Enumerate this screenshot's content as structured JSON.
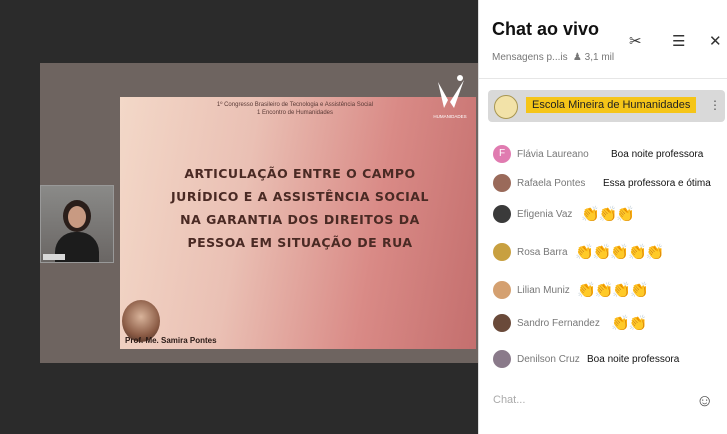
{
  "slide": {
    "header_line1": "1º Congresso Brasileiro de Tecnologia e Assistência Social",
    "header_line2": "1 Encontro de Humanidades",
    "title": "ARTICULAÇÃO ENTRE O CAMPO JURÍDICO E A ASSISTÊNCIA SOCIAL NA GARANTIA DOS DIREITOS DA PESSOA EM SITUAÇÃO DE RUA",
    "presenter": "Prof. Me. Samira Pontes",
    "logo_text": "HUMANIDADES"
  },
  "chat": {
    "title": "Chat ao vivo",
    "subtitle": "Mensagens p...is",
    "viewers": "3,1 mil",
    "pinned": "Escola Mineira de Humanidades",
    "input_placeholder": "Chat...",
    "messages": [
      {
        "author": "Flávia Laureano",
        "text": "Boa noite professora",
        "avatar_color": "#e07bb0",
        "avatar_letter": "F"
      },
      {
        "author": "Rafaela Pontes",
        "text": "Essa professora e ótima",
        "avatar_color": "#9a6a5a"
      },
      {
        "author": "Efigenia Vaz",
        "emoji": "👏👏👏",
        "avatar_color": "#3a3a3a"
      },
      {
        "author": "Rosa Barra",
        "emoji": "👏👏👏👏👏",
        "avatar_color": "#c8a040"
      },
      {
        "author": "Lilian Muniz",
        "emoji": "👏👏👏👏",
        "avatar_color": "#d4a070"
      },
      {
        "author": "Sandro Fernandez",
        "emoji": "👏👏",
        "avatar_color": "#6a4a3a"
      },
      {
        "author": "Denilson Cruz",
        "text": "Boa noite professora",
        "avatar_color": "#8a7a8a"
      }
    ]
  }
}
